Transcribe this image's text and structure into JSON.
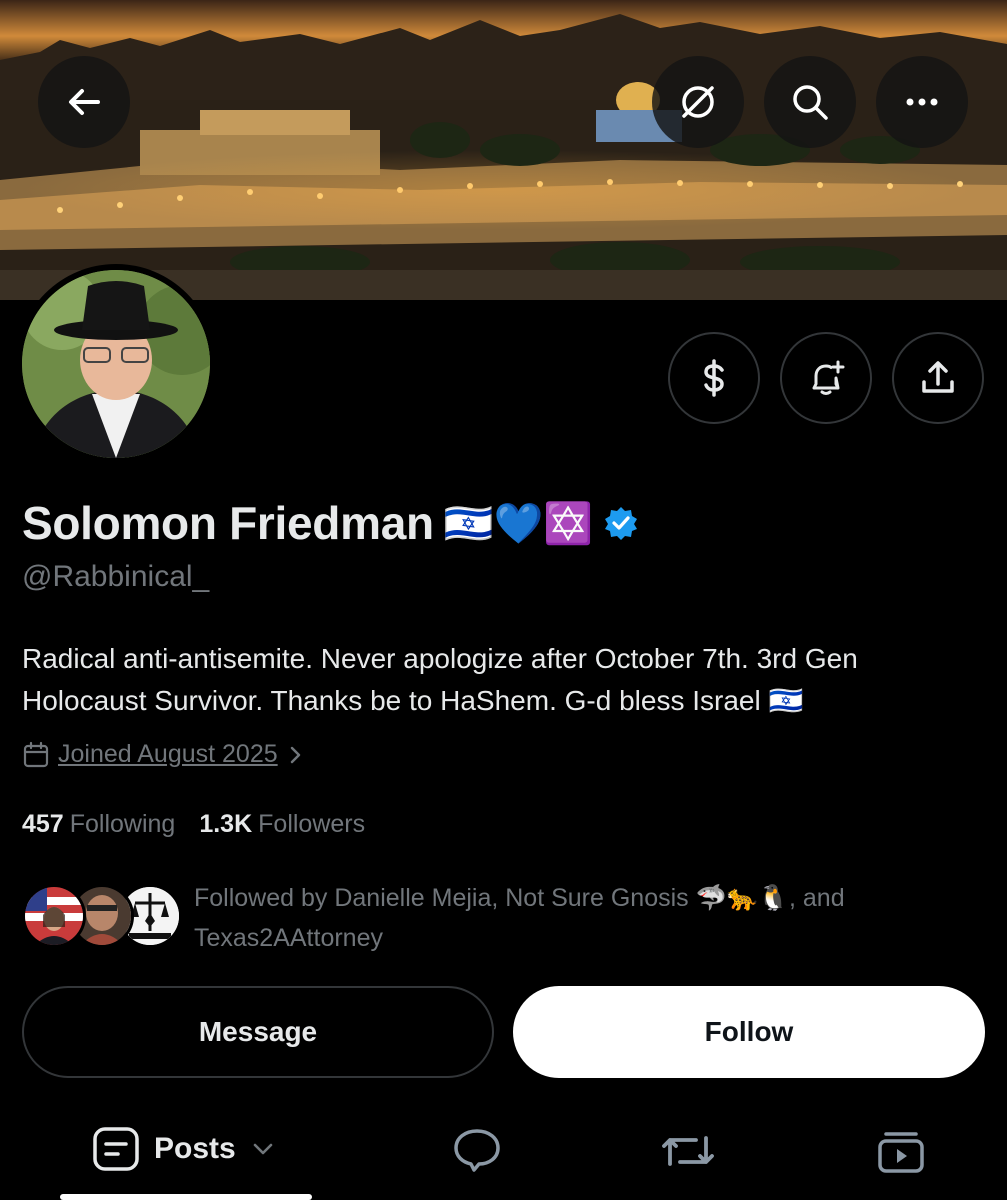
{
  "header": {
    "back_icon": "arrow-left-icon",
    "grok_icon": "slash-circle-icon",
    "search_icon": "search-icon",
    "more_icon": "more-horizontal-icon"
  },
  "actions": {
    "subscribe_icon": "dollar-icon",
    "notify_icon": "bell-plus-icon",
    "share_icon": "share-icon"
  },
  "profile": {
    "name": "Solomon Friedman",
    "name_emojis": "🇮🇱💙✡️",
    "verified": true,
    "handle": "@Rabbinical_",
    "bio": "Radical anti-antisemite. Never apologize after October 7th. 3rd Gen Holocaust Survivor. Thanks be to HaShem. G-d bless Israel 🇮🇱",
    "joined": "Joined August 2025",
    "following_count": "457",
    "following_label": "Following",
    "followers_count": "1.3K",
    "followers_label": "Followers",
    "followed_by": "Followed by Danielle Mejia, Not Sure Gnosis 🦈🐆🐧, and Texas2AAttorney"
  },
  "buttons": {
    "message": "Message",
    "follow": "Follow"
  },
  "tabs": {
    "posts": "Posts"
  },
  "colors": {
    "background": "#000000",
    "text_primary": "#e7e9ea",
    "text_secondary": "#71767b",
    "border": "#333639",
    "verified": "#1d9bf0"
  }
}
